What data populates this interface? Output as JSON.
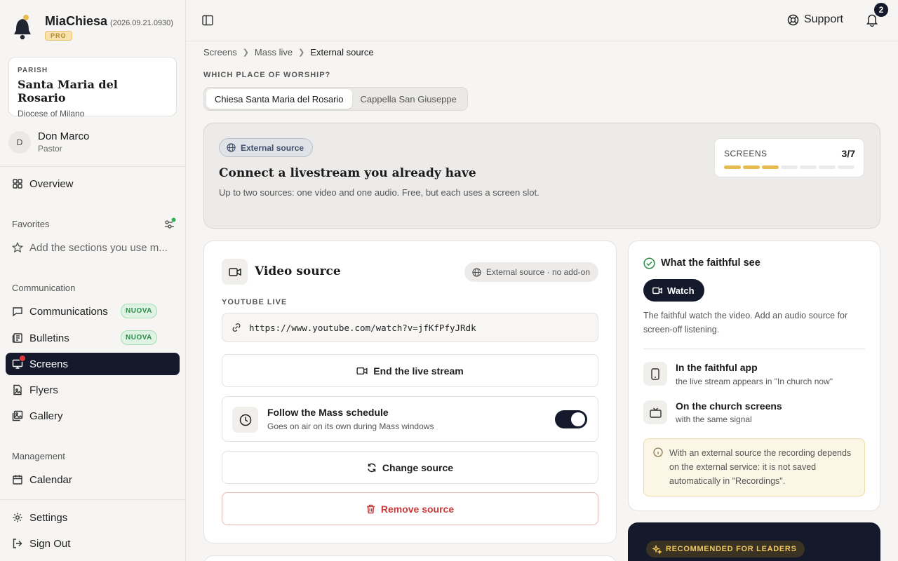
{
  "app": {
    "name": "MiaChiesa",
    "version": "(2026.09.21.0930)",
    "plan_badge": "PRO"
  },
  "parish": {
    "label": "PARISH",
    "name": "Santa Maria del Rosario",
    "diocese": "Diocese of Milano"
  },
  "user": {
    "initial": "D",
    "name": "Don Marco",
    "role": "Pastor"
  },
  "sidebar": {
    "overview": "Overview",
    "favorites_label": "Favorites",
    "favorites_placeholder": "Add the sections you use m...",
    "communication_label": "Communication",
    "communication_items": [
      {
        "label": "Communications",
        "badge": "NUOVA"
      },
      {
        "label": "Bulletins",
        "badge": "NUOVA"
      },
      {
        "label": "Screens",
        "active": true
      },
      {
        "label": "Flyers"
      },
      {
        "label": "Gallery"
      }
    ],
    "management_label": "Management",
    "management_items": [
      {
        "label": "Calendar"
      }
    ],
    "footer_items": [
      {
        "label": "Settings"
      },
      {
        "label": "Sign Out"
      }
    ]
  },
  "topbar": {
    "support": "Support",
    "notification_count": "2"
  },
  "breadcrumb": [
    "Screens",
    "Mass live",
    "External source"
  ],
  "worship": {
    "question": "WHICH PLACE OF WORSHIP?",
    "options": [
      "Chiesa Santa Maria del Rosario",
      "Cappella San Giuseppe"
    ],
    "selected": "Chiesa Santa Maria del Rosario"
  },
  "hero": {
    "chip": "External source",
    "title": "Connect a livestream you already have",
    "description": "Up to two sources: one video and one audio. Free, but each uses a screen slot.",
    "screens_label": "SCREENS",
    "screens_value": "3/7",
    "screens_used": 3,
    "screens_total": 7
  },
  "video": {
    "title": "Video source",
    "tag": "External source · no add-on",
    "source_label": "YOUTUBE LIVE",
    "url": "https://www.youtube.com/watch?v=jfKfPfyJRdk",
    "end_stream": "End the live stream",
    "follow_title": "Follow the Mass schedule",
    "follow_sub": "Goes on air on its own during Mass windows",
    "follow_on": true,
    "change": "Change source",
    "remove": "Remove source"
  },
  "faithful": {
    "title": "What the faithful see",
    "watch": "Watch",
    "desc": "The faithful watch the video. Add an audio source for screen-off listening.",
    "app_title": "In the faithful app",
    "app_sub": "the live stream appears in \"In church now\"",
    "screens_title": "On the church screens",
    "screens_sub": "with the same signal",
    "note": "With an external source the recording depends on the external service: it is not saved automatically in \"Recordings\"."
  },
  "recommended": {
    "label": "RECOMMENDED FOR LEADERS"
  },
  "colors": {
    "dark": "#141a2c",
    "accent_gold": "#e8bb52",
    "success": "#2e8a48",
    "danger": "#c93a3a"
  }
}
